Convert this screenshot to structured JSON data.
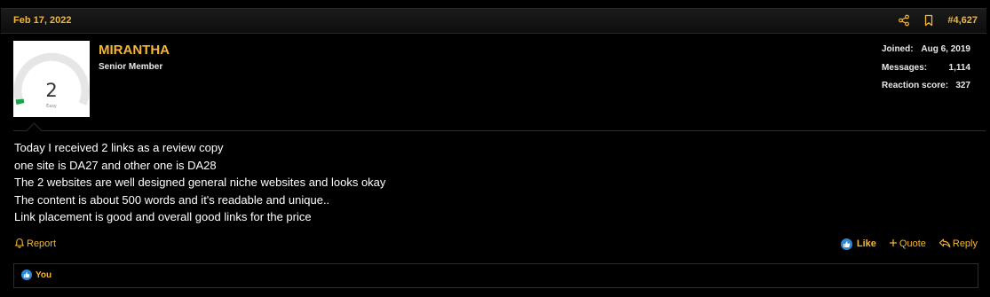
{
  "post": {
    "date": "Feb 17, 2022",
    "number": "#4,627",
    "header_icons": [
      "share-icon",
      "bookmark-icon"
    ]
  },
  "user": {
    "name": "MIRANTHA",
    "title": "Senior Member",
    "avatar": {
      "number": "2",
      "caption": "Easy",
      "accent_color": "#1aa34a"
    },
    "stats": [
      {
        "label": "Joined:",
        "value": "Aug 6, 2019"
      },
      {
        "label": "Messages:",
        "value": "1,114"
      },
      {
        "label": "Reaction score:",
        "value": "327"
      }
    ]
  },
  "message": {
    "lines": [
      "Today I received 2 links as a review copy",
      "one site is DA27 and other one is DA28",
      "The 2 websites are well designed general niche websites and looks okay",
      "The content is about 500 words and it's readable and unique..",
      "Link placement is good and overall good links for the price"
    ]
  },
  "actions": {
    "report": "Report",
    "like": "Like",
    "quote": "Quote",
    "reply": "Reply"
  },
  "reactions": {
    "summary": "You",
    "icon": "like-icon"
  },
  "colors": {
    "accent": "#f5b731",
    "background": "#000000",
    "like_blue": "#2e89d5",
    "border": "#2c2c2c"
  }
}
